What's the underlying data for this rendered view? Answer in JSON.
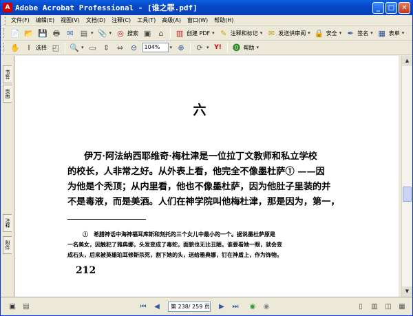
{
  "window": {
    "title": "Adobe Acrobat Professional - [谁之罪.pdf]",
    "minimize": "_",
    "maximize": "□",
    "close": "✕"
  },
  "menu": {
    "items": [
      "文件(F)",
      "编辑(E)",
      "视图(V)",
      "文档(D)",
      "注释(C)",
      "工具(T)",
      "高级(A)",
      "窗口(W)",
      "帮助(H)"
    ]
  },
  "toolbar1": {
    "search_label": "搜索",
    "create_pdf_label": "创建 PDF",
    "comment_label": "注释和标记",
    "review_label": "发送供审阅",
    "security_label": "安全",
    "sign_label": "签名",
    "forms_label": "表单"
  },
  "toolbar2": {
    "select_label": "选择",
    "zoom_value": "104%",
    "help_label": "帮助"
  },
  "nav_tabs": {
    "bookmarks": "书签",
    "pages": "页面",
    "comments": "注释",
    "attachments": "附件"
  },
  "page": {
    "heading": "六",
    "body_lines": [
      "伊万·阿法纳西耶维奇·梅杜津是一位拉丁文教师和私立学校",
      "的校长，人非常之好。从外表上看，他完全不像墨杜萨① ——因",
      "为他是个秃顶；从内里看，他也不像墨杜萨，因为他肚子里装的并",
      "不是毒液，而是美酒。人们在神学院叫他梅杜津，那是因为，第一，"
    ],
    "footnote_lines": [
      "①　希腊神话中海神福耳库斯和刻托的三个女儿中最小的一个。据说墨杜萨原是",
      "一名美女，因触犯了雅典娜，头发变成了毒蛇，面貌也无比丑陋，谁要看她一眼，就会变",
      "成石头，后来被英雄珀耳修斯杀死，割下她的头，送给雅典娜，钉在神盾上，作为饰物。"
    ],
    "page_number": "212"
  },
  "status": {
    "page_indicator": "第 238/ 259 页"
  }
}
